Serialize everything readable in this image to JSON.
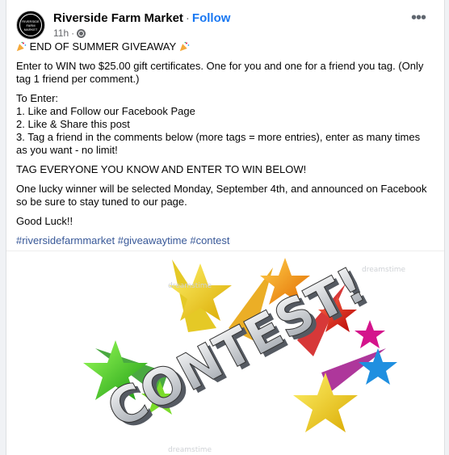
{
  "post": {
    "page_name": "Riverside Farm Market",
    "separator": "·",
    "follow_label": "Follow",
    "time": "11h",
    "time_separator": "·",
    "avatar_text": "RIVERSIDE FARM MARKET",
    "more_label": "•••"
  },
  "content": {
    "headline": "END OF SUMMER GIVEAWAY",
    "intro": "Enter to WIN two $25.00 gift certificates. One for you and one for a friend you tag. (Only tag 1 friend per comment.)",
    "to_enter_title": "To Enter:",
    "steps": [
      "1. Like and Follow our Facebook Page",
      "2. Like & Share this post",
      "3. Tag a friend in the comments below (more tags = more entries), enter as many times as you want - no limit!"
    ],
    "tag_line": "TAG EVERYONE YOU KNOW AND ENTER TO WIN BELOW!",
    "winner_line": "One lucky winner will be selected Monday, September 4th, and announced on Facebook so be sure to stay tuned to our page.",
    "good_luck": "Good Luck!!",
    "hashtags": [
      "#riversidefarmmarket",
      "#giveawaytime",
      "#contest"
    ]
  },
  "image": {
    "word": "CONTEST!",
    "watermark": "dreamstime"
  },
  "colors": {
    "link": "#385898",
    "follow": "#1877f2",
    "text": "#050505",
    "meta": "#65676b"
  }
}
